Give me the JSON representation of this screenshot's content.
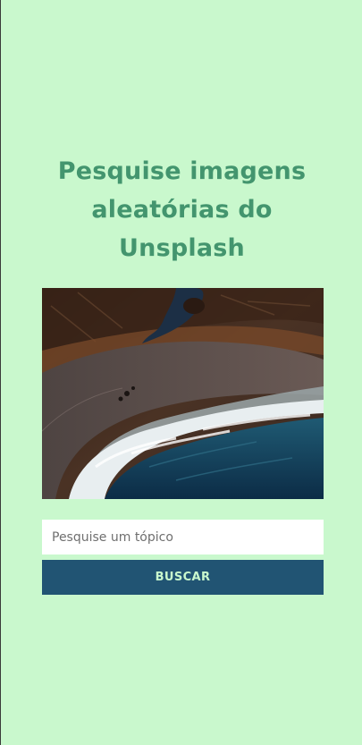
{
  "page": {
    "title_line1": "Pesquise imagens",
    "title_line2": "aleatórias do",
    "title_line3": "Unsplash"
  },
  "image": {
    "subject": "aerial-coastline-photo"
  },
  "search": {
    "placeholder": "Pesquise um tópico",
    "value": "",
    "button_label": "BUSCAR"
  },
  "colors": {
    "background": "#c9f8cd",
    "title": "#43956e",
    "button": "#215473",
    "button_text": "#c9f8cd"
  }
}
